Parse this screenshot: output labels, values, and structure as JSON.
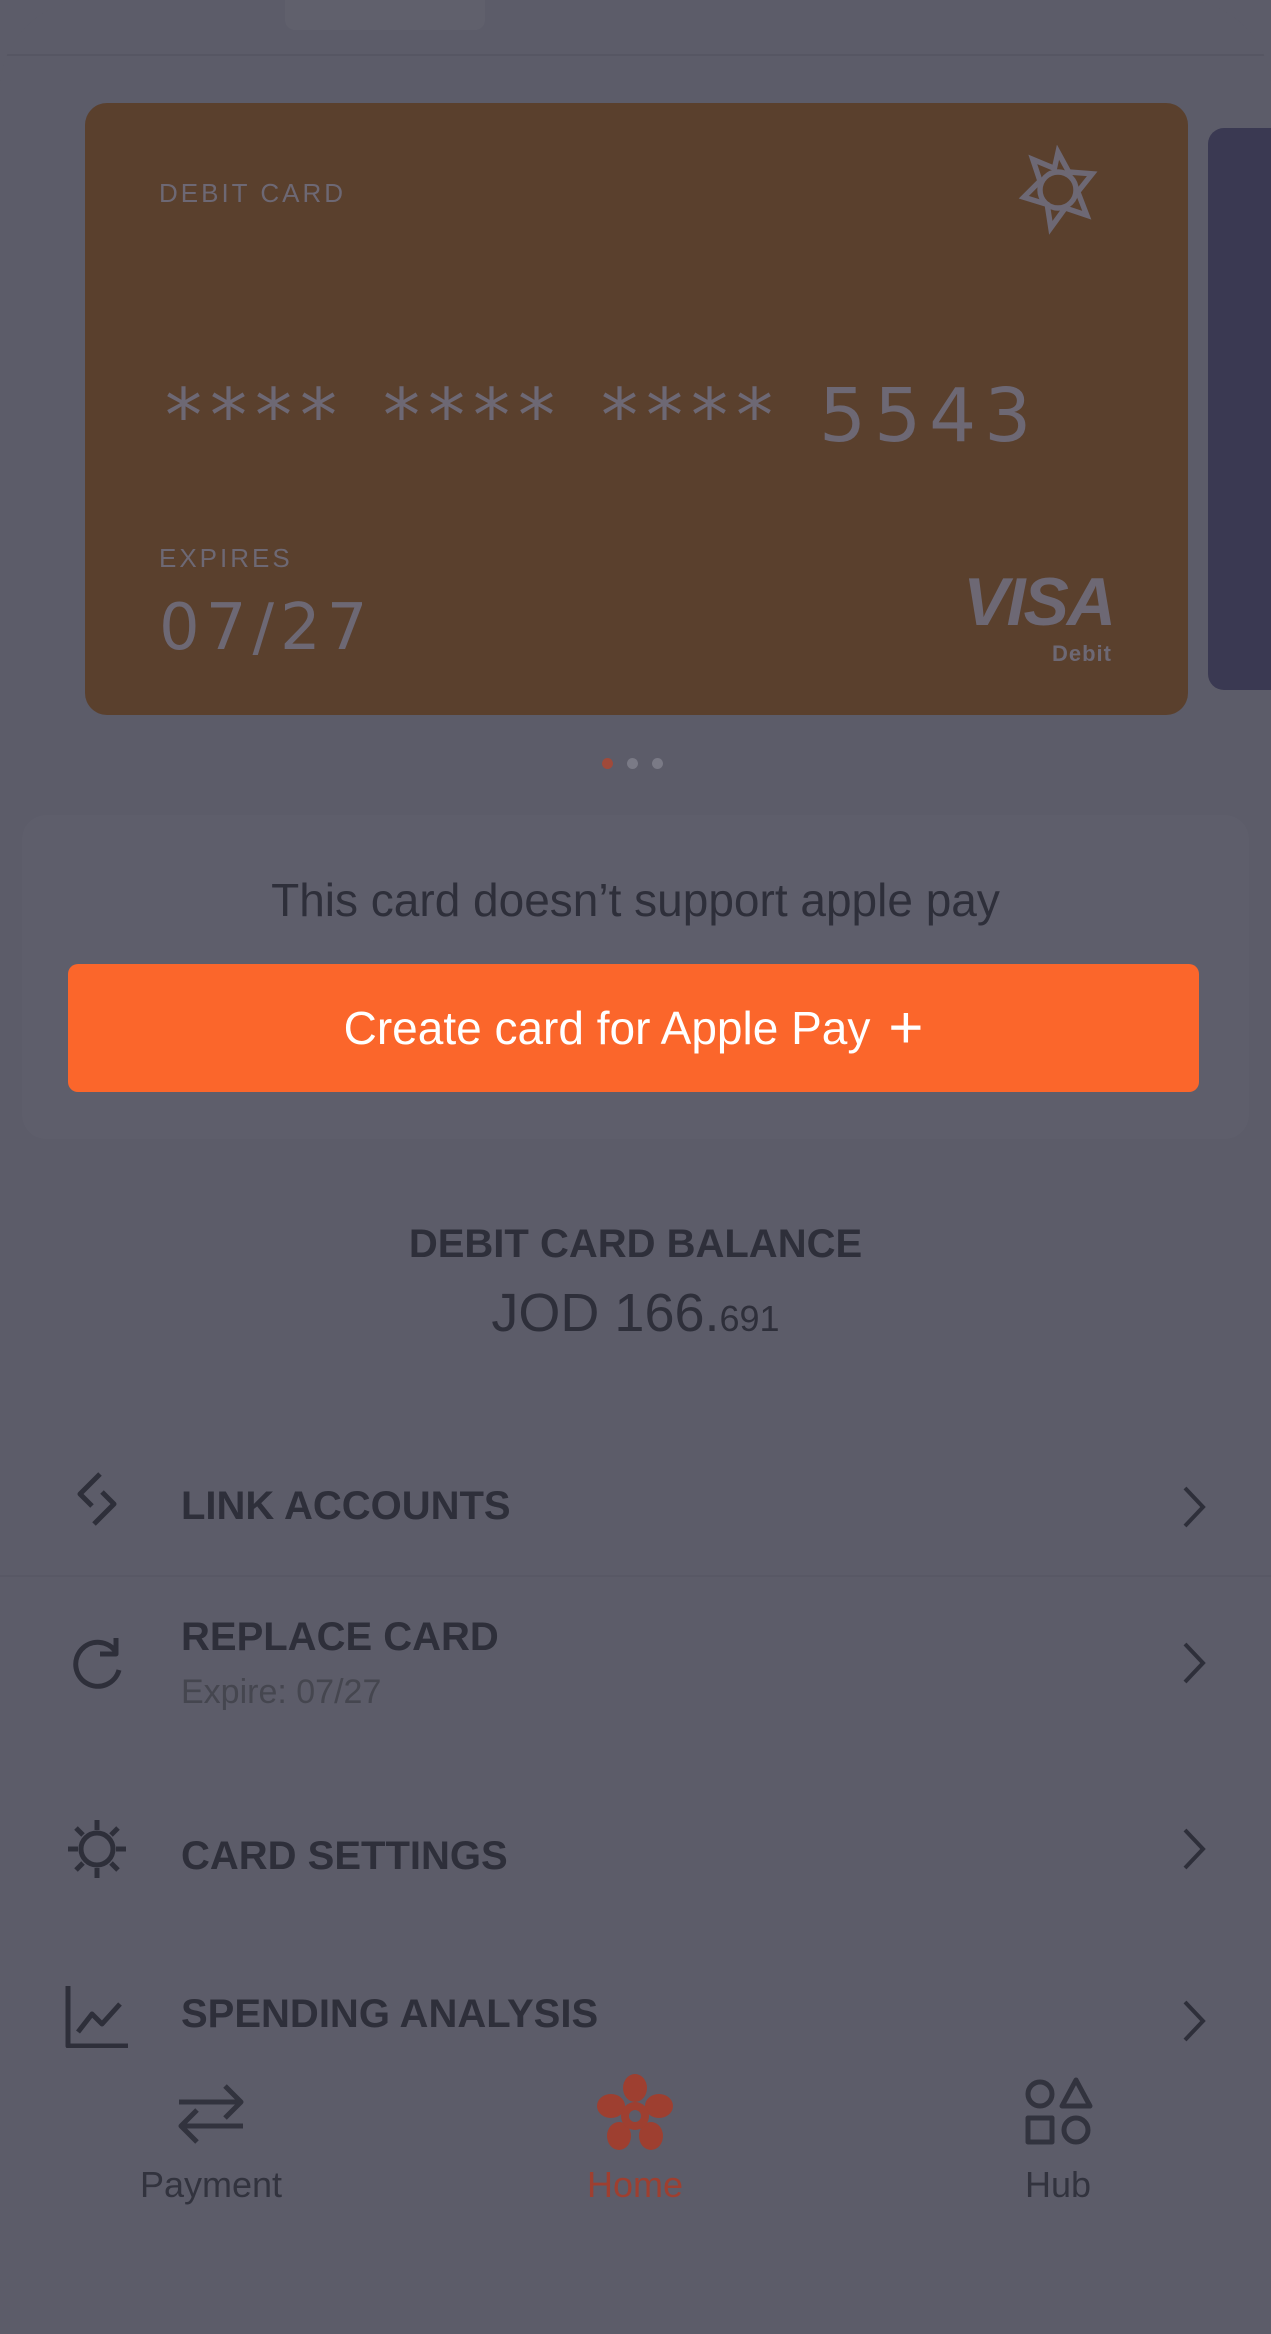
{
  "card": {
    "type_label": "DEBIT CARD",
    "number_groups": [
      "****",
      "****",
      "****",
      "5543"
    ],
    "expires_label": "EXPIRES",
    "expires_value": "07/27",
    "brand": "VISA",
    "brand_sub": "Debit",
    "color": "#5a402d"
  },
  "pager": {
    "total": 3,
    "active_index": 0
  },
  "apple_pay": {
    "message": "This card doesn’t support apple pay",
    "button_label": "Create card for Apple Pay",
    "button_icon": "plus-icon",
    "accent_color": "#fb662b"
  },
  "balance": {
    "label": "DEBIT CARD BALANCE",
    "currency": "JOD",
    "whole": "166.",
    "fraction": "691"
  },
  "menu": {
    "items": [
      {
        "title": "LINK ACCOUNTS",
        "subtitle": "",
        "icon": "link-icon"
      },
      {
        "title": "REPLACE CARD",
        "subtitle": "Expire: 07/27",
        "icon": "refresh-icon"
      },
      {
        "title": "CARD SETTINGS",
        "subtitle": "",
        "icon": "gear-icon"
      },
      {
        "title": "SPENDING ANALYSIS",
        "subtitle": "",
        "icon": "chart-icon"
      }
    ]
  },
  "tabbar": {
    "items": [
      {
        "label": "Payment",
        "icon": "transfer-arrows-icon",
        "active": false
      },
      {
        "label": "Home",
        "icon": "flower-logo-icon",
        "active": true
      },
      {
        "label": "Hub",
        "icon": "shapes-icon",
        "active": false
      }
    ]
  }
}
